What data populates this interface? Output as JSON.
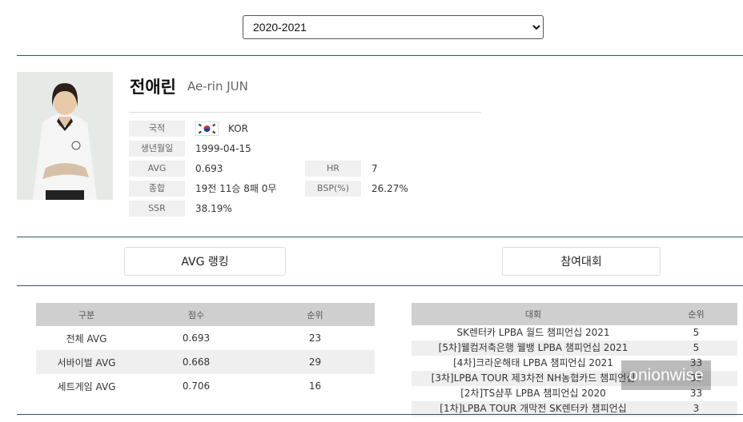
{
  "season_select": {
    "value": "2020-2021",
    "options": [
      "2020-2021"
    ]
  },
  "player": {
    "name_ko": "전애린",
    "name_en": "Ae-rin JUN",
    "labels": {
      "nationality": "국적",
      "birth": "생년월일",
      "avg": "AVG",
      "hr": "HR",
      "record": "종합",
      "bsp": "BSP(%)",
      "ssr": "SSR"
    },
    "nationality": "KOR",
    "birth": "1999-04-15",
    "avg": "0.693",
    "hr": "7",
    "record": "19전 11승 8패 0무",
    "bsp": "26.27%",
    "ssr": "38.19%"
  },
  "tabs": {
    "avg_ranking": "AVG 랭킹",
    "tournaments": "참여대회"
  },
  "avg_table": {
    "headers": [
      "구분",
      "점수",
      "순위"
    ],
    "rows": [
      [
        "전체 AVG",
        "0.693",
        "23"
      ],
      [
        "서바이벌 AVG",
        "0.668",
        "29"
      ],
      [
        "세트게임 AVG",
        "0.706",
        "16"
      ]
    ]
  },
  "tournament_table": {
    "headers": [
      "대회",
      "순위"
    ],
    "rows": [
      [
        "SK렌터카 LPBA 월드 챔피언십 2021",
        "5"
      ],
      [
        "[5차]웰컴저축은행 웰뱅 LPBA 챔피언십 2021",
        "5"
      ],
      [
        "[4차]크라운해태 LPBA 챔피언십 2021",
        "33"
      ],
      [
        "[3차]LPBA TOUR 제3차전 NH농협카드 챔피언십",
        "33"
      ],
      [
        "[2차]TS샴푸 LPBA 챔피언십 2020",
        "33"
      ],
      [
        "[1차]LPBA TOUR 개막전 SK렌터카 챔피언십",
        "3"
      ]
    ]
  },
  "watermark": "onionwise",
  "colors": {
    "rule": "#33536b",
    "header_bg": "#cfcfcf",
    "label_bg": "#f0f0f0",
    "flag_red": "#cd2e3a",
    "flag_blue": "#0047a0"
  }
}
